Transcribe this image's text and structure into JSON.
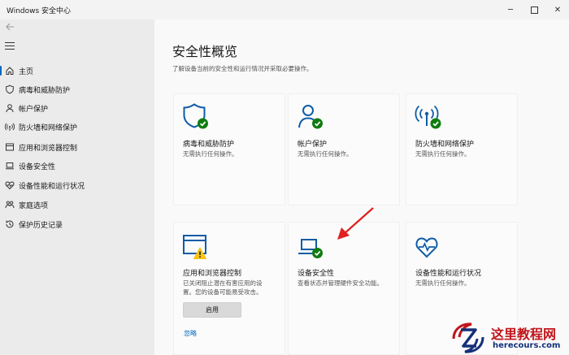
{
  "window": {
    "title": "Windows 安全中心",
    "controls": [
      "minimize-icon",
      "maximize-icon",
      "close-icon"
    ]
  },
  "sidebar": {
    "items": [
      {
        "label": "主页",
        "icon": "home-icon",
        "active": true
      },
      {
        "label": "病毒和威胁防护",
        "icon": "shield-icon"
      },
      {
        "label": "帐户保护",
        "icon": "person-icon"
      },
      {
        "label": "防火墙和网络保护",
        "icon": "wifi-icon"
      },
      {
        "label": "应用和浏览器控制",
        "icon": "app-window-icon"
      },
      {
        "label": "设备安全性",
        "icon": "laptop-icon"
      },
      {
        "label": "设备性能和运行状况",
        "icon": "heart-icon"
      },
      {
        "label": "家庭选项",
        "icon": "family-icon"
      },
      {
        "label": "保护历史记录",
        "icon": "history-icon"
      }
    ]
  },
  "main": {
    "title": "安全性概览",
    "subtitle": "了解设备当前的安全性和运行情况并采取必要操作。",
    "cards": [
      {
        "title": "病毒和威胁防护",
        "status": "无需执行任何操作。",
        "icon": "shield-check-icon"
      },
      {
        "title": "帐户保护",
        "status": "无需执行任何操作。",
        "icon": "person-check-icon"
      },
      {
        "title": "防火墙和网络保护",
        "status": "无需执行任何操作。",
        "icon": "wifi-check-icon"
      },
      {
        "title": "应用和浏览器控制",
        "status_line1": "已关闭阻止潜在有害应用的设",
        "status_line2": "置。您的设备可能易受攻击。",
        "action": "启用",
        "link": "忽略",
        "icon": "app-warning-icon"
      },
      {
        "title": "设备安全性",
        "status": "查看状态并管理硬件安全功能。",
        "icon": "laptop-check-icon"
      },
      {
        "title": "设备性能和运行状况",
        "status": "无需执行任何操作。",
        "icon": "heart-check-icon"
      }
    ]
  },
  "watermark": {
    "name": "这里教程网",
    "url": "herecours.com"
  },
  "colors": {
    "accent": "#0067c0",
    "icon_blue": "#0f5ca6",
    "check_green": "#107c10",
    "warning_yellow": "#f7c315",
    "arrow_red": "#e02020"
  }
}
